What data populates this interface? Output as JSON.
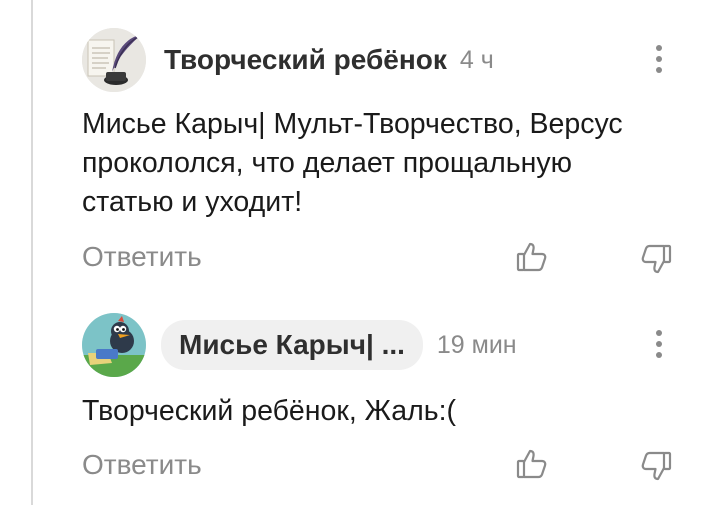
{
  "comments": [
    {
      "author": "Творческий ребёнок",
      "time": "4 ч",
      "avatar_icon": "quill-inkwell-icon",
      "text": "Мисье Карыч| Мульт-Творчество, Версус прокололся, что делает прощальную статью и уходит!",
      "reply_label": "Ответить"
    },
    {
      "author": "Мисье Карыч| ...",
      "time": "19 мин",
      "avatar_icon": "cartoon-crow-icon",
      "text": "Творческий ребёнок, Жаль:(",
      "reply_label": "Ответить"
    }
  ],
  "icons": {
    "more": "kebab-menu-icon",
    "like": "thumbs-up-icon",
    "dislike": "thumbs-down-icon"
  },
  "colors": {
    "text": "#1a1a1a",
    "muted": "#8a8a8a",
    "chip_bg": "#f0f0f0"
  }
}
